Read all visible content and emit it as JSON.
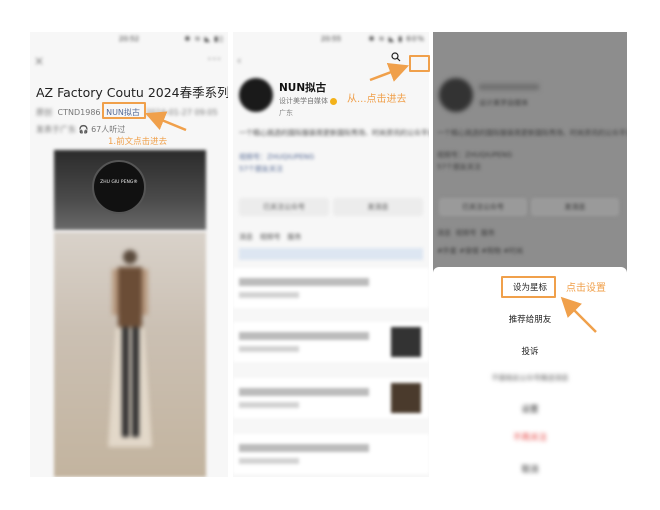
{
  "screen1": {
    "status_time": "20:52",
    "status_icons": "✱ ≋ ◣ ▮▯",
    "close_glyph": "×",
    "more_glyph": "···",
    "article_title": "AZ Factory Coutu 2024春季系列",
    "meta": {
      "tag": "原创",
      "author": "CTND1986",
      "account": "NUN拟古",
      "date": "2024-01-27 09:05",
      "location": "发表于广东",
      "listeners": "67人听过"
    },
    "sign_text": "ZHU GIU PENG®",
    "annotation": "1.前文点击进去"
  },
  "screen2": {
    "status_time": "20:55",
    "status_icons": "✱ ≋ ◣ ▮ 60%",
    "back_glyph": "‹",
    "more_glyph": "···",
    "account_name": "NUN拟古",
    "account_category": "设计美学自媒体",
    "location": "广东",
    "description": "一个精心挑选的国际服装周更新国际秀场、时尚资讯的公众平台",
    "link1": "视频号：ZHUQIUPENG",
    "link2": "57个朋友关注",
    "buttons": [
      "已关注公众号",
      "发消息"
    ],
    "tabs": [
      "消息",
      "视频号",
      "服务"
    ],
    "annotation": "从...点击进去"
  },
  "screen3": {
    "account_category": "设计美学自媒体",
    "desc": "一个精心挑选的国际服装周更新国际秀场、时尚资讯的公众平台",
    "link1": "视频号：ZHUQIUPENG",
    "link2": "57个朋友关注",
    "buttons": [
      "已关注公众号",
      "发消息"
    ],
    "tabs": [
      "消息",
      "视频号",
      "服务"
    ],
    "tags": "#外套 #穿搭 #购物 #时尚",
    "menu": {
      "star": "设为星标",
      "recommend": "推荐给朋友",
      "complain": "投诉",
      "blurred1": "不接收此公众号推送消息",
      "blurred2": "设置",
      "unfollow": "不再关注",
      "cancel": "取消"
    },
    "annotation": "点击设置"
  },
  "colors": {
    "annotation": "#f0a04b",
    "link": "#576b95",
    "danger": "#e64340"
  }
}
